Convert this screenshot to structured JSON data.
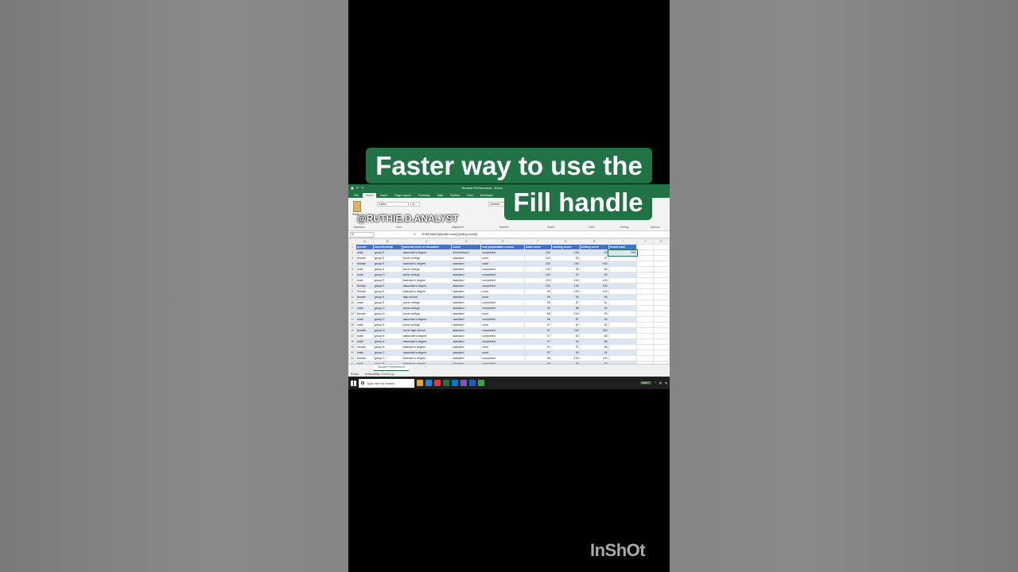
{
  "overlay": {
    "caption_line1": "Faster way to use the",
    "caption_line2": "Fill handle",
    "handle": "@RUTHIE.D.ANALYST",
    "watermark": "InShOt"
  },
  "excel": {
    "doc_title": "Student Performance - Excel",
    "menu_tabs": [
      "File",
      "Home",
      "Insert",
      "Page Layout",
      "Formulas",
      "Data",
      "Review",
      "View",
      "Developer"
    ],
    "active_tab": "Home",
    "ribbon": {
      "paste_label": "Paste",
      "font_name": "Calibri",
      "font_size": "11",
      "number_format": "General",
      "groups": [
        "Clipboard",
        "Font",
        "Alignment",
        "Number",
        "Styles",
        "Cells",
        "Editing",
        "Add-ins"
      ],
      "add_in": "Add-ins"
    },
    "name_box": "I2",
    "fx": "fx",
    "formula": "=SUM(Table1[@[math score]:[writing score]])",
    "columns": [
      "",
      "A",
      "B",
      "C",
      "D",
      "E",
      "F",
      "G",
      "H",
      "I",
      "J",
      "K"
    ],
    "headers": [
      "gender",
      "race/ethnicity",
      "parental level of education",
      "lunch",
      "test preparation course",
      "math score",
      "reading score",
      "writing score",
      "Grand total"
    ],
    "rows": [
      [
        "male",
        "group E",
        "associate's degree",
        "free/reduced",
        "completed",
        "100",
        "100",
        "93",
        "293"
      ],
      [
        "female",
        "group E",
        "some college",
        "standard",
        "none",
        "100",
        "92",
        "97",
        ""
      ],
      [
        "female",
        "group E",
        "bachelor's degree",
        "standard",
        "none",
        "100",
        "100",
        "100",
        ""
      ],
      [
        "male",
        "group A",
        "some college",
        "standard",
        "completed",
        "100",
        "96",
        "86",
        ""
      ],
      [
        "male",
        "group D",
        "some college",
        "standard",
        "completed",
        "100",
        "97",
        "99",
        ""
      ],
      [
        "male",
        "group E",
        "bachelor's degree",
        "standard",
        "completed",
        "100",
        "100",
        "100",
        ""
      ],
      [
        "female",
        "group E",
        "associate's degree",
        "standard",
        "completed",
        "100",
        "100",
        "100",
        ""
      ],
      [
        "female",
        "group E",
        "bachelor's degree",
        "standard",
        "none",
        "99",
        "100",
        "100",
        ""
      ],
      [
        "female",
        "group E",
        "high school",
        "standard",
        "none",
        "99",
        "93",
        "90",
        ""
      ],
      [
        "male",
        "group E",
        "some college",
        "standard",
        "completed",
        "99",
        "87",
        "81",
        ""
      ],
      [
        "male",
        "group C",
        "some college",
        "standard",
        "completed",
        "99",
        "88",
        "90",
        ""
      ],
      [
        "female",
        "group D",
        "some college",
        "standard",
        "none",
        "98",
        "100",
        "99",
        ""
      ],
      [
        "male",
        "group C",
        "associate's degree",
        "standard",
        "completed",
        "98",
        "87",
        "90",
        ""
      ],
      [
        "male",
        "group E",
        "some college",
        "standard",
        "none",
        "97",
        "87",
        "82",
        ""
      ],
      [
        "female",
        "group D",
        "some high school",
        "standard",
        "completed",
        "97",
        "100",
        "100",
        ""
      ],
      [
        "male",
        "group E",
        "associate's degree",
        "standard",
        "completed",
        "97",
        "82",
        "88",
        ""
      ],
      [
        "male",
        "group A",
        "associate's degree",
        "standard",
        "completed",
        "97",
        "92",
        "86",
        ""
      ],
      [
        "female",
        "group B",
        "bachelor's degree",
        "standard",
        "none",
        "97",
        "97",
        "96",
        ""
      ],
      [
        "male",
        "group C",
        "associate's degree",
        "standard",
        "none",
        "97",
        "93",
        "91",
        ""
      ],
      [
        "female",
        "group C",
        "bachelor's degree",
        "standard",
        "completed",
        "96",
        "100",
        "100",
        ""
      ],
      [
        "male",
        "group E",
        "bachelor's degree",
        "standard",
        "completed",
        "96",
        "90",
        "92",
        ""
      ],
      [
        "female",
        "group C",
        "associate's degree",
        "standard",
        "completed",
        "96",
        "96",
        "99",
        ""
      ]
    ],
    "sheet_tab": "Student Performance",
    "sheet_add": "+",
    "status_ready": "Ready",
    "status_accessibility": "Accessibility: Good to go",
    "taskbar_search": "Type here to search",
    "tray_label": "AWDT"
  }
}
